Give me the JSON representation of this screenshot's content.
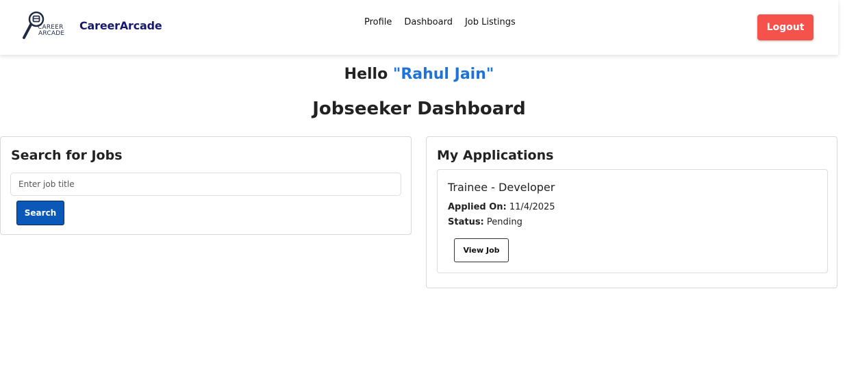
{
  "navbar": {
    "logo": {
      "word1": "CAREER",
      "word2": "ARCADE",
      "icon": "magnifier-icon"
    },
    "brand_name": "CareerArcade",
    "links": [
      "Profile",
      "Dashboard",
      "Job Listings"
    ],
    "logout_label": "Logout"
  },
  "greeting": {
    "prefix": "Hello",
    "user_name": "\"Rahul Jain\""
  },
  "dashboard_title": "Jobseeker Dashboard",
  "search_card": {
    "title": "Search for Jobs",
    "input_placeholder": "Enter job title",
    "input_value": "",
    "button_label": "Search"
  },
  "applications_card": {
    "title": "My Applications",
    "items": [
      {
        "job_title": "Trainee - Developer",
        "applied_label": "Applied On:",
        "applied_value": "11/4/2025",
        "status_label": "Status:",
        "status_value": "Pending",
        "button_label": "View Job"
      }
    ]
  },
  "colors": {
    "brand": "#161a6e",
    "logout": "#f5524b",
    "primary": "#0a58b8",
    "username": "#1e73d8"
  }
}
